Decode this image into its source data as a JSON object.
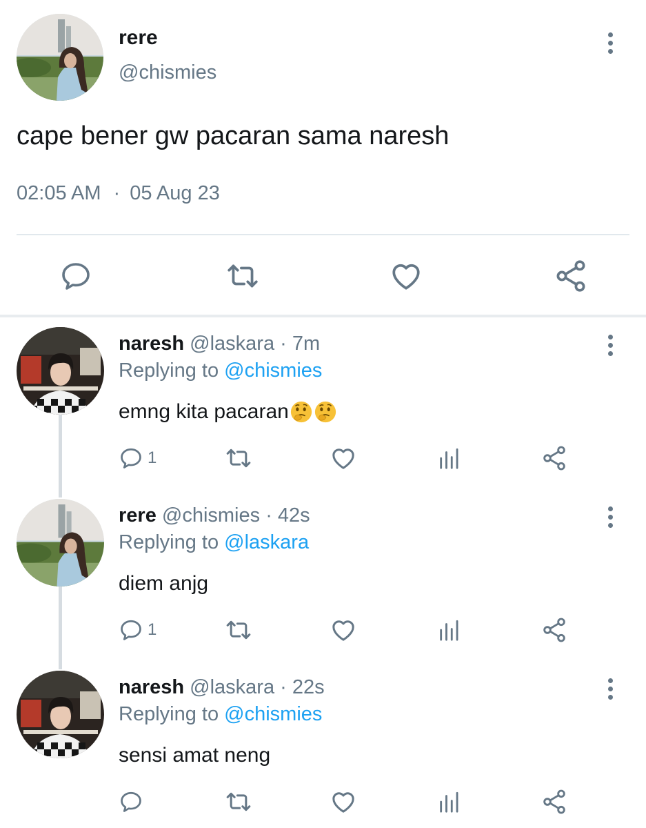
{
  "main_tweet": {
    "name": "rere",
    "handle": "@chismies",
    "text": "cape bener gw pacaran sama naresh",
    "time": "02:05 AM",
    "separator": "·",
    "date": "05 Aug 23"
  },
  "replies": [
    {
      "name": "naresh",
      "handle": "@laskara",
      "time": "· 7m",
      "replying_prefix": "Replying to",
      "replying_to": "@chismies",
      "text": "emng kita pacaran",
      "emojis": [
        "thinking-face-emoji",
        "thinking-face-emoji"
      ],
      "reply_count": "1"
    },
    {
      "name": "rere",
      "handle": "@chismies",
      "time": "· 42s",
      "replying_prefix": "Replying to",
      "replying_to": "@laskara",
      "text": "diem anjg",
      "emojis": [],
      "reply_count": "1"
    },
    {
      "name": "naresh",
      "handle": "@laskara",
      "time": "· 22s",
      "replying_prefix": "Replying to",
      "replying_to": "@chismies",
      "text": "sensi amat neng",
      "emojis": [],
      "reply_count": ""
    }
  ],
  "icons": {
    "reply": "speech-bubble-icon",
    "retweet": "retweet-icon",
    "like": "heart-icon",
    "analytics": "bar-chart-icon",
    "share": "share-icon",
    "more": "three-dots-vertical-icon"
  },
  "colors": {
    "text": "#14171a",
    "secondary": "#657786",
    "link": "#1da1f2",
    "divider": "#e1e8ed"
  }
}
